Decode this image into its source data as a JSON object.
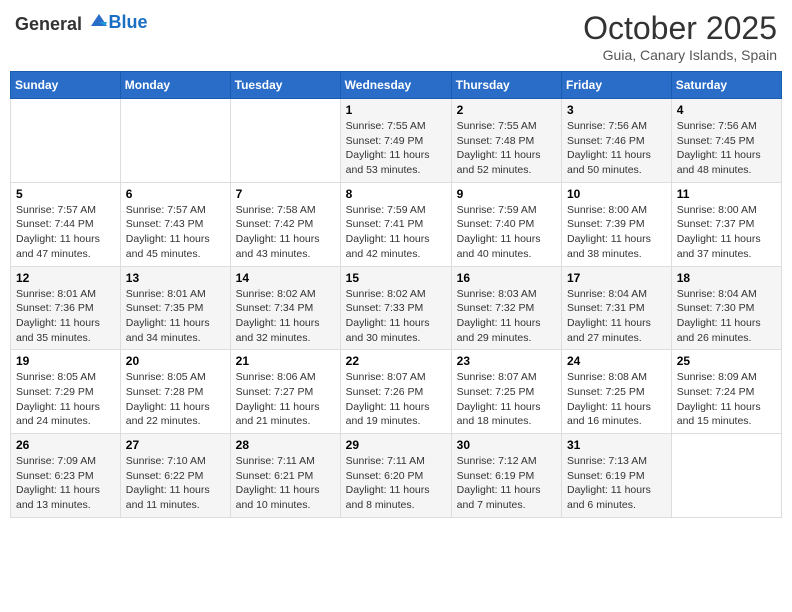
{
  "header": {
    "logo_general": "General",
    "logo_blue": "Blue",
    "month_title": "October 2025",
    "subtitle": "Guia, Canary Islands, Spain"
  },
  "days_of_week": [
    "Sunday",
    "Monday",
    "Tuesday",
    "Wednesday",
    "Thursday",
    "Friday",
    "Saturday"
  ],
  "weeks": [
    [
      {
        "day": "",
        "content": ""
      },
      {
        "day": "",
        "content": ""
      },
      {
        "day": "",
        "content": ""
      },
      {
        "day": "1",
        "content": "Sunrise: 7:55 AM\nSunset: 7:49 PM\nDaylight: 11 hours and 53 minutes."
      },
      {
        "day": "2",
        "content": "Sunrise: 7:55 AM\nSunset: 7:48 PM\nDaylight: 11 hours and 52 minutes."
      },
      {
        "day": "3",
        "content": "Sunrise: 7:56 AM\nSunset: 7:46 PM\nDaylight: 11 hours and 50 minutes."
      },
      {
        "day": "4",
        "content": "Sunrise: 7:56 AM\nSunset: 7:45 PM\nDaylight: 11 hours and 48 minutes."
      }
    ],
    [
      {
        "day": "5",
        "content": "Sunrise: 7:57 AM\nSunset: 7:44 PM\nDaylight: 11 hours and 47 minutes."
      },
      {
        "day": "6",
        "content": "Sunrise: 7:57 AM\nSunset: 7:43 PM\nDaylight: 11 hours and 45 minutes."
      },
      {
        "day": "7",
        "content": "Sunrise: 7:58 AM\nSunset: 7:42 PM\nDaylight: 11 hours and 43 minutes."
      },
      {
        "day": "8",
        "content": "Sunrise: 7:59 AM\nSunset: 7:41 PM\nDaylight: 11 hours and 42 minutes."
      },
      {
        "day": "9",
        "content": "Sunrise: 7:59 AM\nSunset: 7:40 PM\nDaylight: 11 hours and 40 minutes."
      },
      {
        "day": "10",
        "content": "Sunrise: 8:00 AM\nSunset: 7:39 PM\nDaylight: 11 hours and 38 minutes."
      },
      {
        "day": "11",
        "content": "Sunrise: 8:00 AM\nSunset: 7:37 PM\nDaylight: 11 hours and 37 minutes."
      }
    ],
    [
      {
        "day": "12",
        "content": "Sunrise: 8:01 AM\nSunset: 7:36 PM\nDaylight: 11 hours and 35 minutes."
      },
      {
        "day": "13",
        "content": "Sunrise: 8:01 AM\nSunset: 7:35 PM\nDaylight: 11 hours and 34 minutes."
      },
      {
        "day": "14",
        "content": "Sunrise: 8:02 AM\nSunset: 7:34 PM\nDaylight: 11 hours and 32 minutes."
      },
      {
        "day": "15",
        "content": "Sunrise: 8:02 AM\nSunset: 7:33 PM\nDaylight: 11 hours and 30 minutes."
      },
      {
        "day": "16",
        "content": "Sunrise: 8:03 AM\nSunset: 7:32 PM\nDaylight: 11 hours and 29 minutes."
      },
      {
        "day": "17",
        "content": "Sunrise: 8:04 AM\nSunset: 7:31 PM\nDaylight: 11 hours and 27 minutes."
      },
      {
        "day": "18",
        "content": "Sunrise: 8:04 AM\nSunset: 7:30 PM\nDaylight: 11 hours and 26 minutes."
      }
    ],
    [
      {
        "day": "19",
        "content": "Sunrise: 8:05 AM\nSunset: 7:29 PM\nDaylight: 11 hours and 24 minutes."
      },
      {
        "day": "20",
        "content": "Sunrise: 8:05 AM\nSunset: 7:28 PM\nDaylight: 11 hours and 22 minutes."
      },
      {
        "day": "21",
        "content": "Sunrise: 8:06 AM\nSunset: 7:27 PM\nDaylight: 11 hours and 21 minutes."
      },
      {
        "day": "22",
        "content": "Sunrise: 8:07 AM\nSunset: 7:26 PM\nDaylight: 11 hours and 19 minutes."
      },
      {
        "day": "23",
        "content": "Sunrise: 8:07 AM\nSunset: 7:25 PM\nDaylight: 11 hours and 18 minutes."
      },
      {
        "day": "24",
        "content": "Sunrise: 8:08 AM\nSunset: 7:25 PM\nDaylight: 11 hours and 16 minutes."
      },
      {
        "day": "25",
        "content": "Sunrise: 8:09 AM\nSunset: 7:24 PM\nDaylight: 11 hours and 15 minutes."
      }
    ],
    [
      {
        "day": "26",
        "content": "Sunrise: 7:09 AM\nSunset: 6:23 PM\nDaylight: 11 hours and 13 minutes."
      },
      {
        "day": "27",
        "content": "Sunrise: 7:10 AM\nSunset: 6:22 PM\nDaylight: 11 hours and 11 minutes."
      },
      {
        "day": "28",
        "content": "Sunrise: 7:11 AM\nSunset: 6:21 PM\nDaylight: 11 hours and 10 minutes."
      },
      {
        "day": "29",
        "content": "Sunrise: 7:11 AM\nSunset: 6:20 PM\nDaylight: 11 hours and 8 minutes."
      },
      {
        "day": "30",
        "content": "Sunrise: 7:12 AM\nSunset: 6:19 PM\nDaylight: 11 hours and 7 minutes."
      },
      {
        "day": "31",
        "content": "Sunrise: 7:13 AM\nSunset: 6:19 PM\nDaylight: 11 hours and 6 minutes."
      },
      {
        "day": "",
        "content": ""
      }
    ]
  ]
}
